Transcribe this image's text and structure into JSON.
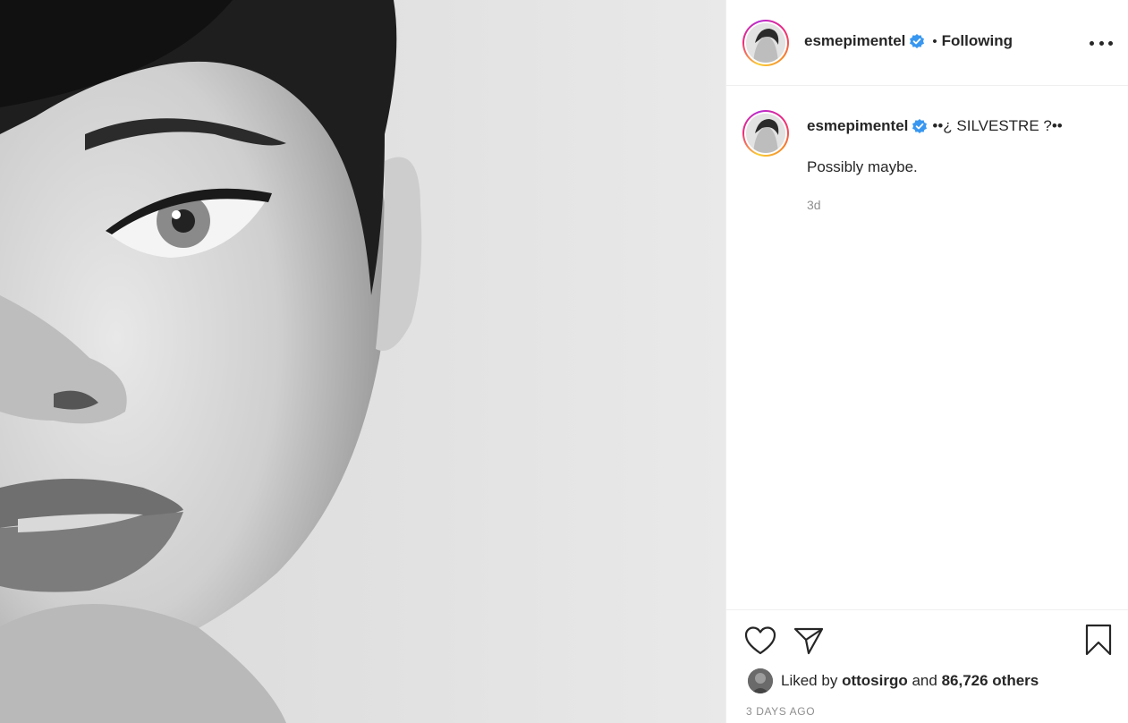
{
  "post": {
    "author": "esmepimentel",
    "follow_state": "Following",
    "separator": "•",
    "verified_icon": "verified-badge-icon",
    "more_icon": "more-options-icon"
  },
  "caption": {
    "author": "esmepimentel",
    "title": "••¿ SILVESTRE ?••",
    "body": "Possibly maybe.",
    "time": "3d"
  },
  "actions": {
    "like_icon": "heart-icon",
    "share_icon": "paper-plane-icon",
    "save_icon": "bookmark-icon"
  },
  "likes": {
    "prefix": "Liked by",
    "user": "ottosirgo",
    "joiner": "and",
    "count": "86,726 others"
  },
  "posted": "3 DAYS AGO",
  "colors": {
    "verified": "#3897f0",
    "text": "#262626",
    "muted": "#8e8e8e",
    "border": "#efefef"
  }
}
